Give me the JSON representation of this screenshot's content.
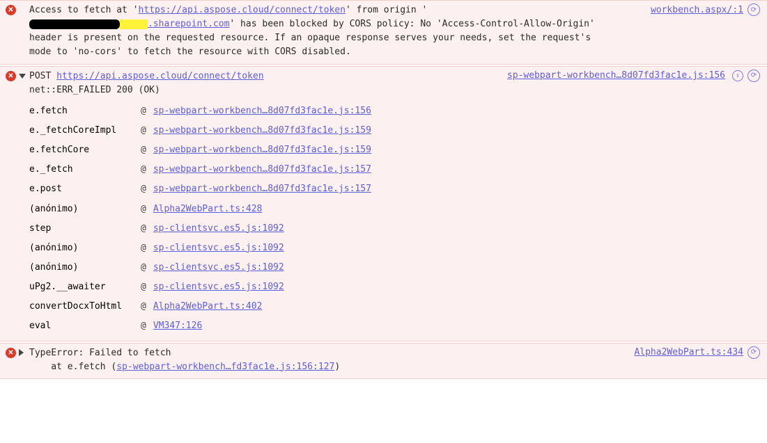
{
  "entries": [
    {
      "type": "cors",
      "source": "workbench.aspx/:1",
      "msg_pre": "Access to fetch at '",
      "msg_url1": "https://api.aspose.cloud/connect/token",
      "msg_mid1": "' from origin '",
      "redact_black_w": 130,
      "redact_yellow_w": 40,
      "msg_url2": ".sharepoint.com",
      "msg_tail": "' has been blocked by CORS policy: No 'Access-Control-Allow-Origin' header is present on the requested resource. If an opaque response serves your needs, set the request's mode to 'no-cors' to fetch the resource with CORS disabled."
    },
    {
      "type": "netfail",
      "source": "sp-webpart-workbench…8d07fd3fac1e.js:156",
      "method": "POST",
      "url": "https://api.aspose.cloud/connect/token",
      "status": "net::ERR_FAILED 200 (OK)",
      "stack": [
        {
          "fn": "e.fetch",
          "where": "sp-webpart-workbench…8d07fd3fac1e.js:156"
        },
        {
          "fn": "e._fetchCoreImpl",
          "where": "sp-webpart-workbench…8d07fd3fac1e.js:159"
        },
        {
          "fn": "e.fetchCore",
          "where": "sp-webpart-workbench…8d07fd3fac1e.js:159"
        },
        {
          "fn": "e._fetch",
          "where": "sp-webpart-workbench…8d07fd3fac1e.js:157"
        },
        {
          "fn": "e.post",
          "where": "sp-webpart-workbench…8d07fd3fac1e.js:157"
        },
        {
          "fn": "(anónimo)",
          "where": "Alpha2WebPart.ts:428"
        },
        {
          "fn": "step",
          "where": "sp-clientsvc.es5.js:1092"
        },
        {
          "fn": "(anónimo)",
          "where": "sp-clientsvc.es5.js:1092"
        },
        {
          "fn": "(anónimo)",
          "where": "sp-clientsvc.es5.js:1092"
        },
        {
          "fn": "uPg2.__awaiter",
          "where": "sp-clientsvc.es5.js:1092"
        },
        {
          "fn": "convertDocxToHtml",
          "where": "Alpha2WebPart.ts:402"
        },
        {
          "fn": "eval",
          "where": "VM347:126"
        }
      ]
    },
    {
      "type": "typeerr",
      "source": "Alpha2WebPart.ts:434",
      "title": "TypeError: Failed to fetch",
      "line2_pre": "    at e.fetch (",
      "line2_link": "sp-webpart-workbench…fd3fac1e.js:156:127",
      "line2_post": ")"
    }
  ],
  "glyphs": {
    "err": "✕",
    "ai": "⟳",
    "rebind": "↕"
  }
}
